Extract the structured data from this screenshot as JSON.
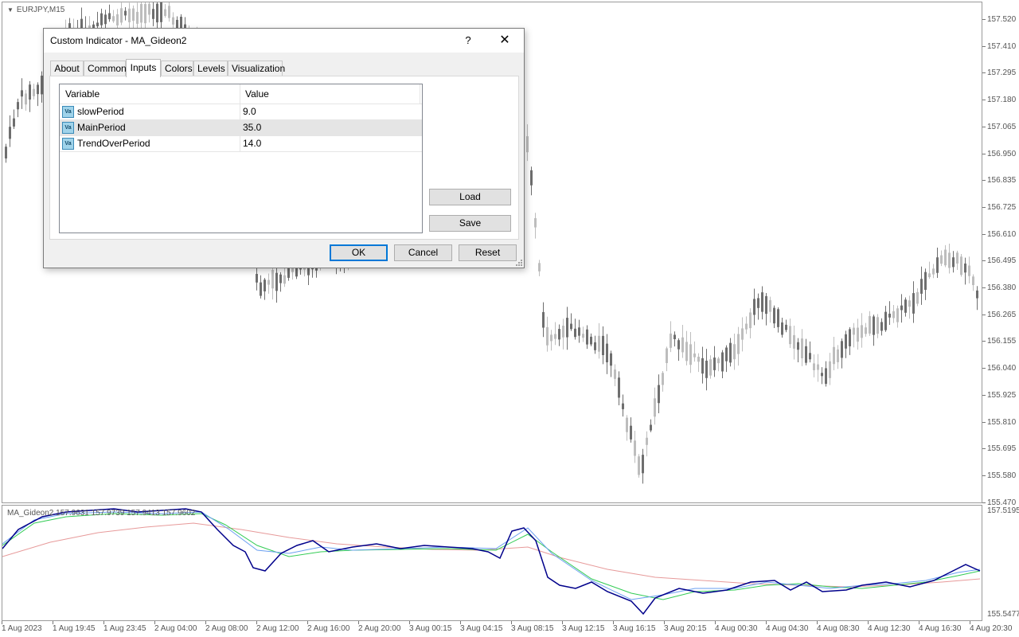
{
  "chart": {
    "symbol": "EURJPY,M15",
    "price_ticks": [
      "157.520",
      "157.410",
      "157.295",
      "157.180",
      "157.065",
      "156.950",
      "156.835",
      "156.725",
      "156.610",
      "156.495",
      "156.380",
      "156.265",
      "156.155",
      "156.040",
      "155.925",
      "155.810",
      "155.695",
      "155.580",
      "155.470"
    ],
    "indicator_label": "MA_Gideon2 157.9631 157.9739 157.9413 157.9602",
    "indicator_scale_top": "157.5195",
    "indicator_scale_bottom": "155.5477",
    "time_ticks": [
      "1 Aug 2023",
      "1 Aug 19:45",
      "1 Aug 23:45",
      "2 Aug 04:00",
      "2 Aug 08:00",
      "2 Aug 12:00",
      "2 Aug 16:00",
      "2 Aug 20:00",
      "3 Aug 00:15",
      "3 Aug 04:15",
      "3 Aug 08:15",
      "3 Aug 12:15",
      "3 Aug 16:15",
      "3 Aug 20:15",
      "4 Aug 00:30",
      "4 Aug 04:30",
      "4 Aug 08:30",
      "4 Aug 12:30",
      "4 Aug 16:30",
      "4 Aug 20:30"
    ],
    "colors": {
      "bull_candle": "#bdbdbd",
      "bear_candle": "#6e6e6e",
      "ma_main": "#00008b",
      "ma_blue_light": "#6a9ff0",
      "ma_green": "#33cc55",
      "ma_pink": "#e79a9a"
    }
  },
  "dialog": {
    "title": "Custom Indicator - MA_Gideon2",
    "help_label": "?",
    "close_label": "✕",
    "tabs": [
      {
        "label": "About"
      },
      {
        "label": "Common"
      },
      {
        "label": "Inputs"
      },
      {
        "label": "Colors"
      },
      {
        "label": "Levels"
      },
      {
        "label": "Visualization"
      }
    ],
    "active_tab": "Inputs",
    "grid": {
      "col_variable": "Variable",
      "col_value": "Value",
      "rows": [
        {
          "icon": "Va",
          "variable": "slowPeriod",
          "value": "9.0"
        },
        {
          "icon": "Va",
          "variable": "MainPeriod",
          "value": "35.0"
        },
        {
          "icon": "Va",
          "variable": "TrendOverPeriod",
          "value": "14.0"
        }
      ]
    },
    "load_label": "Load",
    "save_label": "Save",
    "ok_label": "OK",
    "cancel_label": "Cancel",
    "reset_label": "Reset"
  }
}
